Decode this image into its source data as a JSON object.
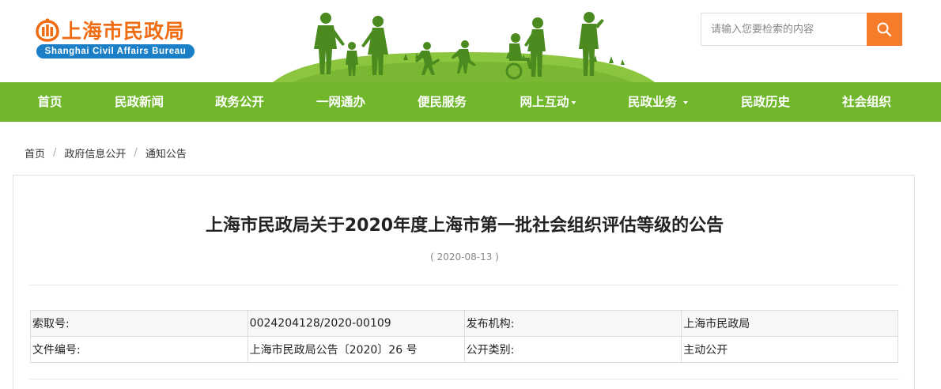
{
  "header": {
    "logo_cn": "上海市民政局",
    "logo_en": "Shanghai Civil Affairs Bureau",
    "brand_orange": "#ef6c13",
    "brand_blue": "#1a7fc6"
  },
  "search": {
    "placeholder": "请输入您要检索的内容",
    "button_icon": "search-icon",
    "button_color": "#f47c2a"
  },
  "nav": {
    "color": "#70b72b",
    "items": [
      {
        "label": "首页"
      },
      {
        "label": "民政新闻"
      },
      {
        "label": "政务公开"
      },
      {
        "label": "一网通办"
      },
      {
        "label": "便民服务"
      },
      {
        "label": "网上互动",
        "dropdown": true
      },
      {
        "label": "民政业务",
        "dropdown": true
      },
      {
        "label": "民政历史"
      },
      {
        "label": "社会组织"
      }
    ]
  },
  "breadcrumb": [
    "首页",
    "政府信息公开",
    "通知公告"
  ],
  "article": {
    "title": "上海市民政局关于2020年度上海市第一批社会组织评估等级的公告",
    "date": "( 2020-08-13 )",
    "meta": [
      [
        "索取号:",
        "0024204128/2020-00109",
        "发布机构:",
        "上海市民政局"
      ],
      [
        "文件编号:",
        "上海市民政局公告〔2020〕26 号",
        "公开类别:",
        "主动公开"
      ]
    ]
  }
}
